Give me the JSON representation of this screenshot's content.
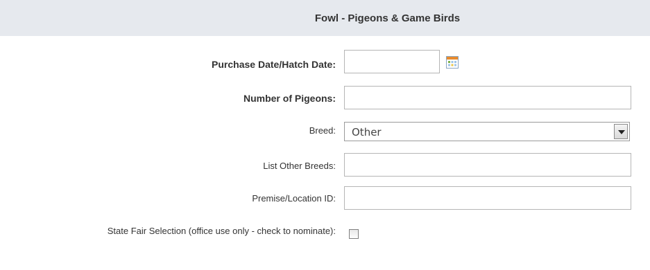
{
  "header": {
    "title": "Fowl - Pigeons & Game Birds"
  },
  "form": {
    "purchase_date_label": "Purchase Date/Hatch Date:",
    "purchase_date_value": "",
    "number_label": "Number of Pigeons:",
    "number_value": "",
    "breed_label": "Breed:",
    "breed_value": "Other",
    "other_breeds_label": "List Other Breeds:",
    "other_breeds_value": "",
    "premise_label": "Premise/Location ID:",
    "premise_value": "",
    "state_fair_label": "State Fair Selection (office use only - check to nominate):",
    "state_fair_checked": false
  },
  "icons": {
    "calendar": "calendar-icon",
    "dropdown": "chevron-down-icon"
  },
  "colors": {
    "header_bg": "#e6e9ee",
    "border": "#b5b5b5"
  }
}
